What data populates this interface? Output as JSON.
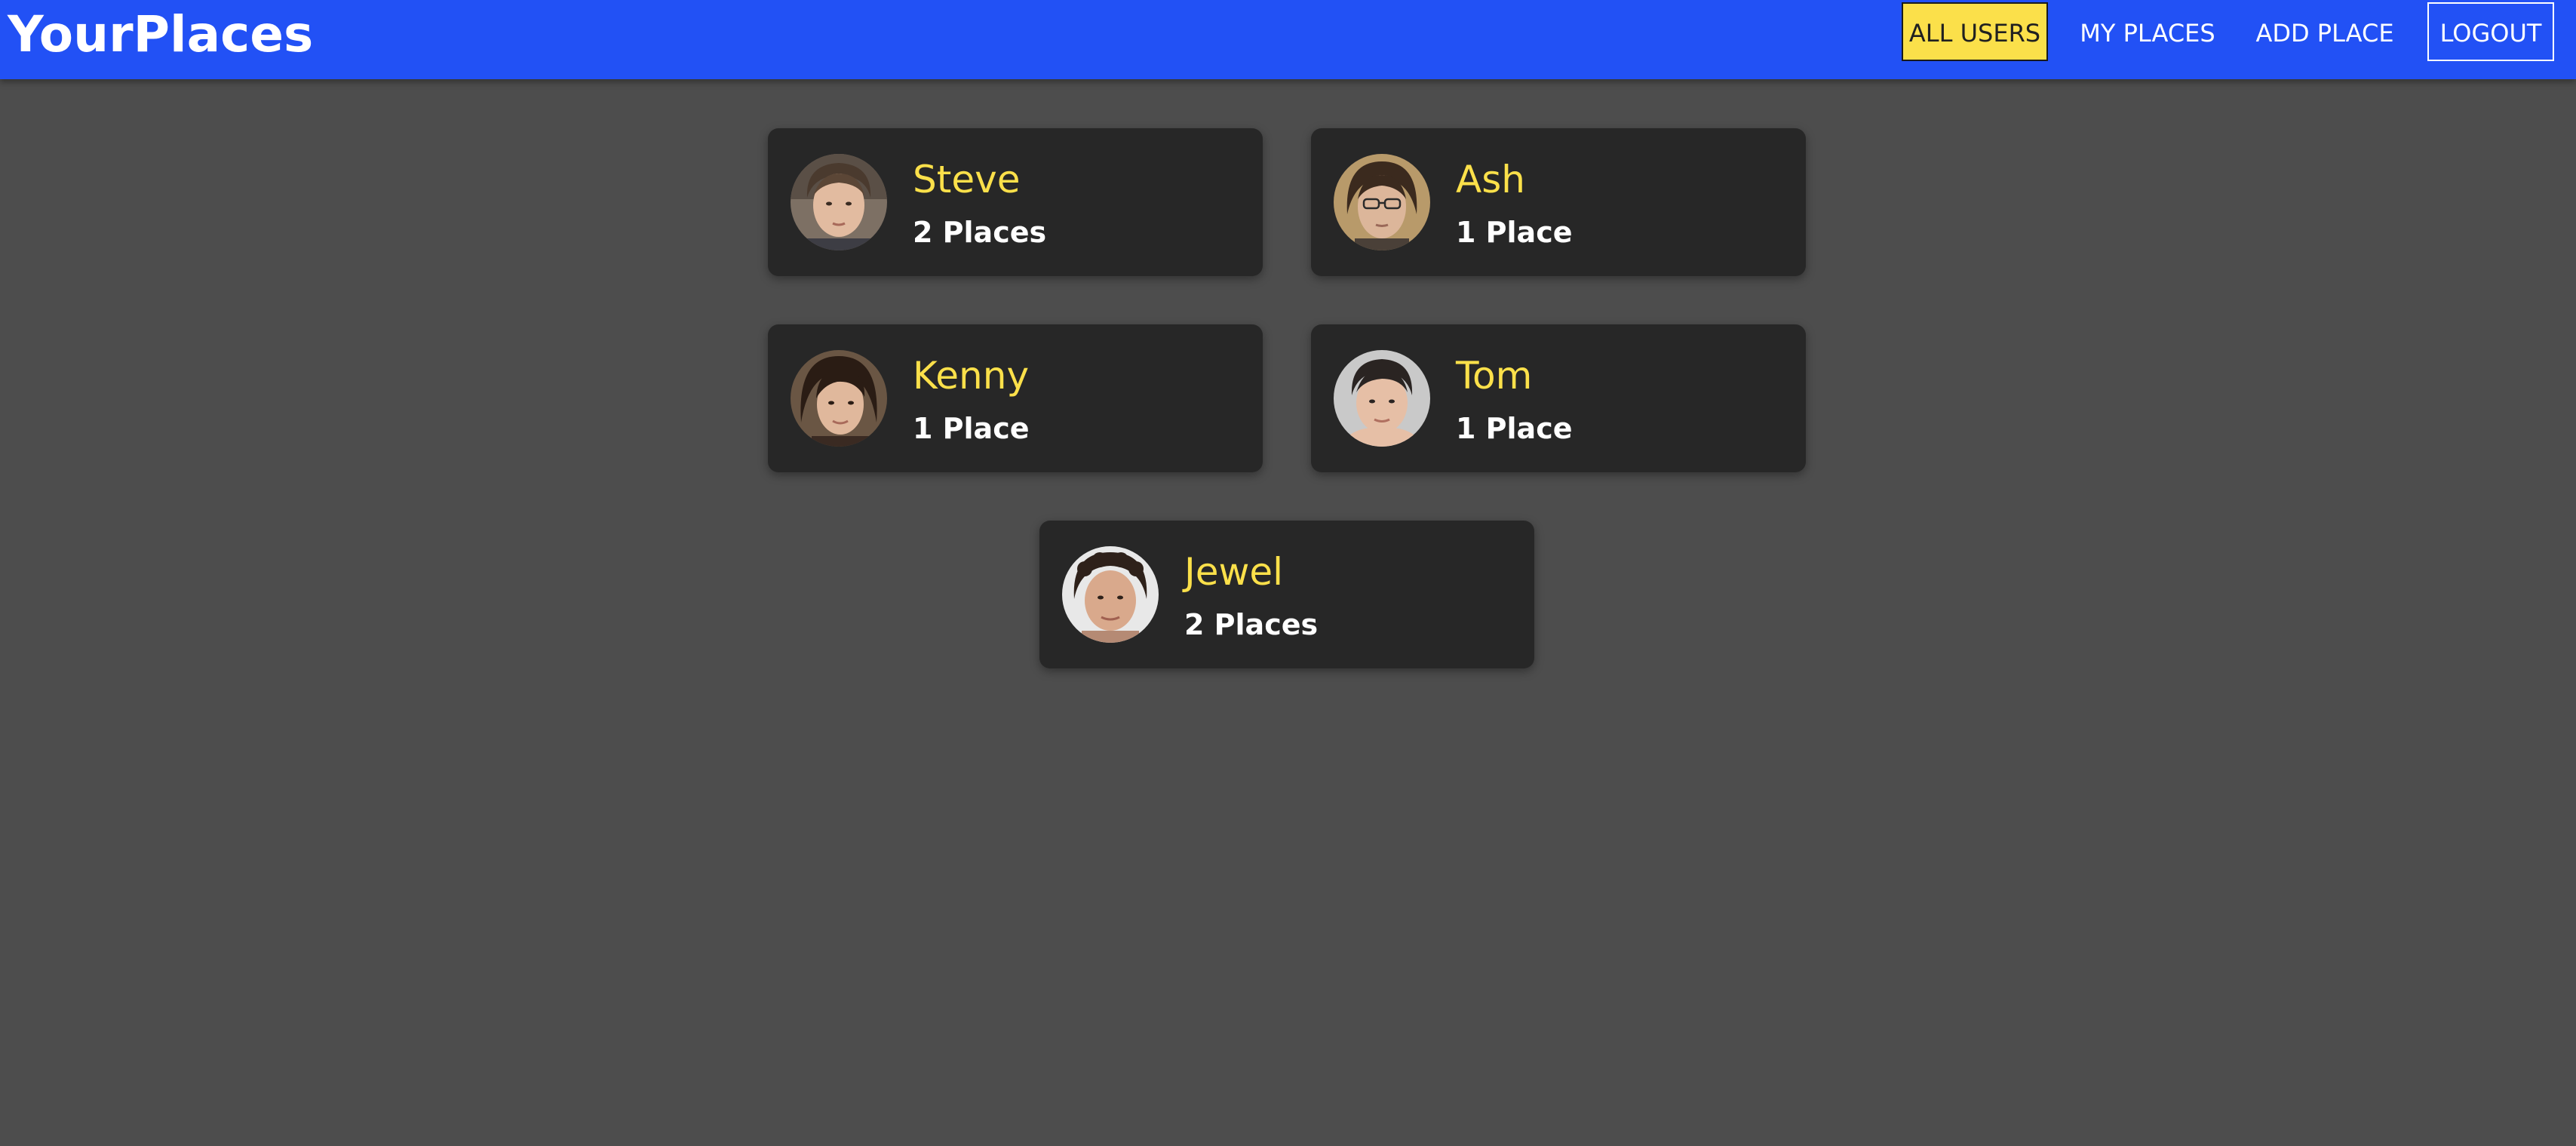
{
  "header": {
    "logo": "YourPlaces",
    "nav": {
      "all_users": "ALL USERS",
      "my_places": "MY PLACES",
      "add_place": "ADD PLACE",
      "logout": "LOGOUT"
    },
    "active_nav": "all_users"
  },
  "users": [
    {
      "name": "Steve",
      "places": "2 Places"
    },
    {
      "name": "Ash",
      "places": "1 Place"
    },
    {
      "name": "Kenny",
      "places": "1 Place"
    },
    {
      "name": "Tom",
      "places": "1 Place"
    },
    {
      "name": "Jewel",
      "places": "2 Places"
    }
  ],
  "colors": {
    "header_bg": "#2251f5",
    "page_bg": "#4d4d4d",
    "card_bg": "#272727",
    "accent_yellow": "#fbe04a",
    "text_white": "#ffffff"
  }
}
